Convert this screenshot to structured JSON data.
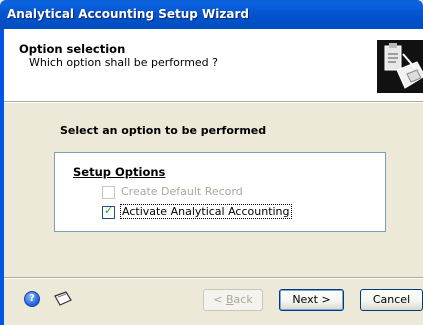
{
  "window": {
    "title": "Analytical Accounting Setup Wizard"
  },
  "header": {
    "title": "Option selection",
    "subtitle": "Which option shall be performed ?",
    "icon": "wizard-clipboard-icon"
  },
  "section_label": "Select an option to be performed",
  "setup_options": {
    "title": "Setup Options",
    "options": [
      {
        "label": "Create Default Record",
        "checked": false,
        "enabled": false
      },
      {
        "label": "Activate Analytical Accounting",
        "checked": true,
        "enabled": true
      }
    ]
  },
  "footer": {
    "help_icon": "help-icon",
    "note_icon": "note-icon",
    "back_label_pre": "<",
    "back_label_access": "B",
    "back_label_post": "ack",
    "next_label": "Next >",
    "cancel_label": "Cancel"
  },
  "colors": {
    "titlebar": "#0054e3",
    "dialog_bg": "#ece9d8",
    "checkmark": "#21a121"
  }
}
